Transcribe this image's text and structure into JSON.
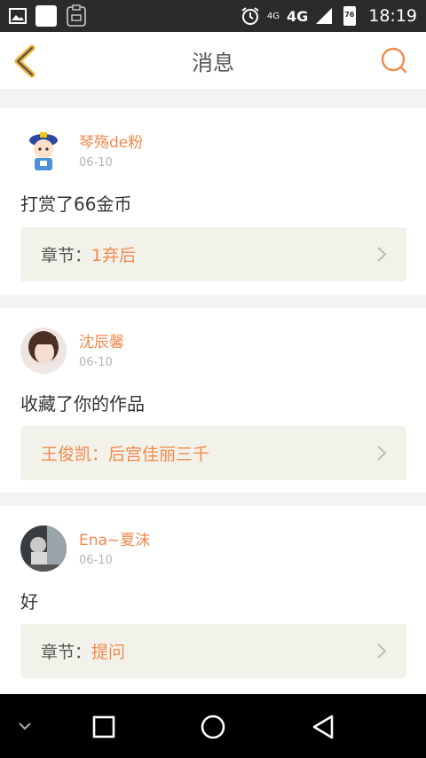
{
  "status_bar": {
    "time": "18:19",
    "network": "4G",
    "network_small": "4G",
    "battery": "76"
  },
  "header": {
    "title": "消息"
  },
  "messages": [
    {
      "user": "琴殇de粉",
      "date": "06-10",
      "text": "打赏了66金币",
      "link_label": "章节：",
      "link_value": "1弃后"
    },
    {
      "user": "沈辰馨",
      "date": "06-10",
      "text": "收藏了你的作品",
      "link_label": "",
      "link_value": "王俊凯：后宫佳丽三千"
    },
    {
      "user": "Ena~夏沫",
      "date": "06-10",
      "text": "好",
      "link_label": "章节：",
      "link_value": "提问"
    }
  ],
  "colors": {
    "accent": "#f08a4b",
    "back_arrow": "#f2b532",
    "card_link_bg": "#f3f2ea"
  }
}
